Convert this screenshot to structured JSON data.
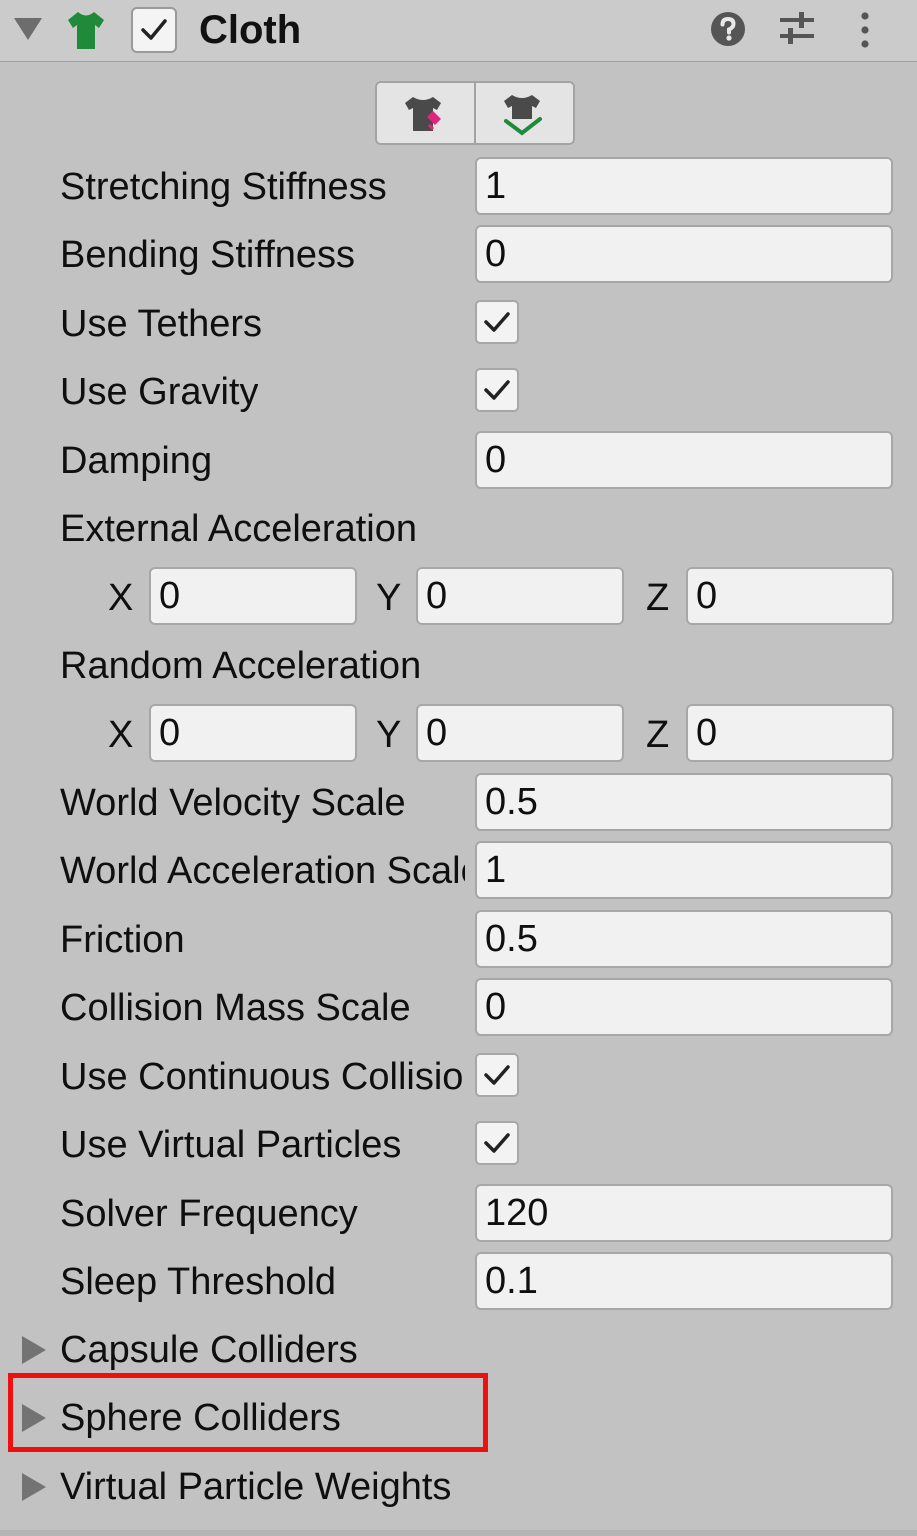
{
  "header": {
    "title": "Cloth",
    "enabled": true,
    "fold_icon": "fold-down-arrow-icon",
    "component_icon": "shirt-icon",
    "help_icon": "question-icon",
    "presets_icon": "sliders-icon",
    "menu_icon": "vertical-dots-icon"
  },
  "tools": {
    "edit_constraints_icon": "cloth-paint-icon",
    "self_collision_icon": "cloth-collision-icon"
  },
  "properties": {
    "stretching_stiffness": {
      "label": "Stretching Stiffness",
      "value": "1"
    },
    "bending_stiffness": {
      "label": "Bending Stiffness",
      "value": "0"
    },
    "use_tethers": {
      "label": "Use Tethers",
      "checked": true
    },
    "use_gravity": {
      "label": "Use Gravity",
      "checked": true
    },
    "damping": {
      "label": "Damping",
      "value": "0"
    },
    "external_acceleration": {
      "label": "External Acceleration",
      "x_label": "X",
      "x": "0",
      "y_label": "Y",
      "y": "0",
      "z_label": "Z",
      "z": "0"
    },
    "random_acceleration": {
      "label": "Random Acceleration",
      "x_label": "X",
      "x": "0",
      "y_label": "Y",
      "y": "0",
      "z_label": "Z",
      "z": "0"
    },
    "world_velocity_scale": {
      "label": "World Velocity Scale",
      "value": "0.5"
    },
    "world_acceleration_scale": {
      "label": "World Acceleration Scale",
      "value": "1"
    },
    "friction": {
      "label": "Friction",
      "value": "0.5"
    },
    "collision_mass_scale": {
      "label": "Collision Mass Scale",
      "value": "0"
    },
    "use_continuous_collision": {
      "label": "Use Continuous Collision",
      "checked": true
    },
    "use_virtual_particles": {
      "label": "Use Virtual Particles",
      "checked": true
    },
    "solver_frequency": {
      "label": "Solver Frequency",
      "value": "120"
    },
    "sleep_threshold": {
      "label": "Sleep Threshold",
      "value": "0.1"
    }
  },
  "foldouts": {
    "capsule_colliders": "Capsule Colliders",
    "sphere_colliders": "Sphere Colliders",
    "virtual_particle_weights": "Virtual Particle Weights"
  },
  "colors": {
    "panel_bg": "#c2c2c2",
    "field_bg": "#f1f1f1",
    "highlight": "#ee0f0f",
    "shirt_green": "#1f8a3a",
    "paint_pink": "#e0257a"
  }
}
